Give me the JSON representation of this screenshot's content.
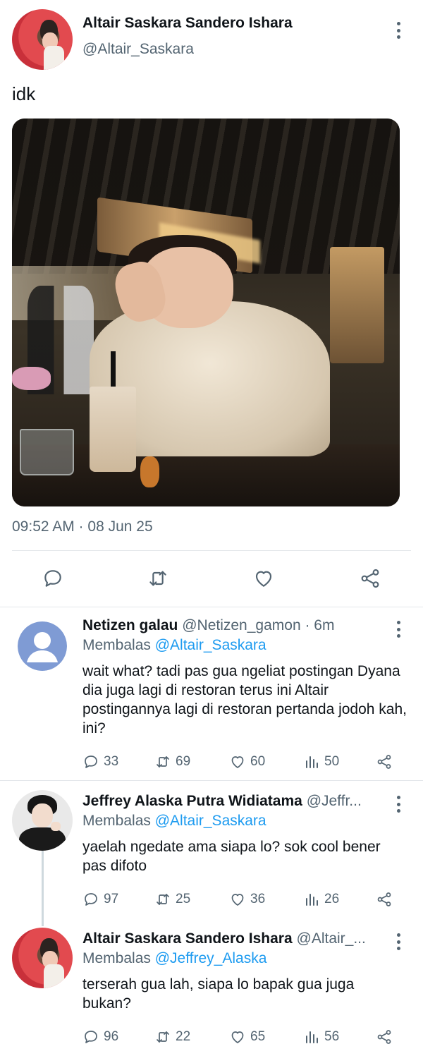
{
  "main_tweet": {
    "author_name": "Altair Saskara Sandero Ishara",
    "author_handle": "@Altair_Saskara",
    "text": "idk",
    "timestamp": "09:52 AM · 08 Jun 25",
    "photo_alt": "",
    "actions": {
      "reply_icon": "comment-icon",
      "retweet_icon": "retweet-icon",
      "like_icon": "heart-icon",
      "share_icon": "share-icon"
    }
  },
  "replies": [
    {
      "name": "Netizen galau",
      "handle": "@Netizen_gamon",
      "time": "· 6m",
      "replying_prefix": "Membalas",
      "replying_to": "@Altair_Saskara",
      "text": "wait what? tadi pas gua ngeliat postingan Dyana dia juga lagi di restoran terus ini Altair postingannya lagi di restoran pertanda jodoh kah, ini?",
      "comments": "33",
      "retweets": "69",
      "likes": "60",
      "views": "50"
    },
    {
      "name": "Jeffrey Alaska Putra Widiatama",
      "handle": "@Jeffr...",
      "time": "",
      "replying_prefix": "Membalas",
      "replying_to": "@Altair_Saskara",
      "text": "yaelah ngedate ama siapa lo? sok cool bener pas difoto",
      "comments": "97",
      "retweets": "25",
      "likes": "36",
      "views": "26"
    },
    {
      "name": "Altair Saskara Sandero Ishara",
      "handle": "@Altair_...",
      "time": "",
      "replying_prefix": "Membalas",
      "replying_to": "@Jeffrey_Alaska",
      "text": "terserah gua lah, siapa lo bapak gua juga bukan?",
      "comments": "96",
      "retweets": "22",
      "likes": "65",
      "views": "56"
    }
  ],
  "colors": {
    "text": "#0f1419",
    "muted": "#536471",
    "link": "#1d9bf0",
    "divider": "#e3e6ea"
  }
}
